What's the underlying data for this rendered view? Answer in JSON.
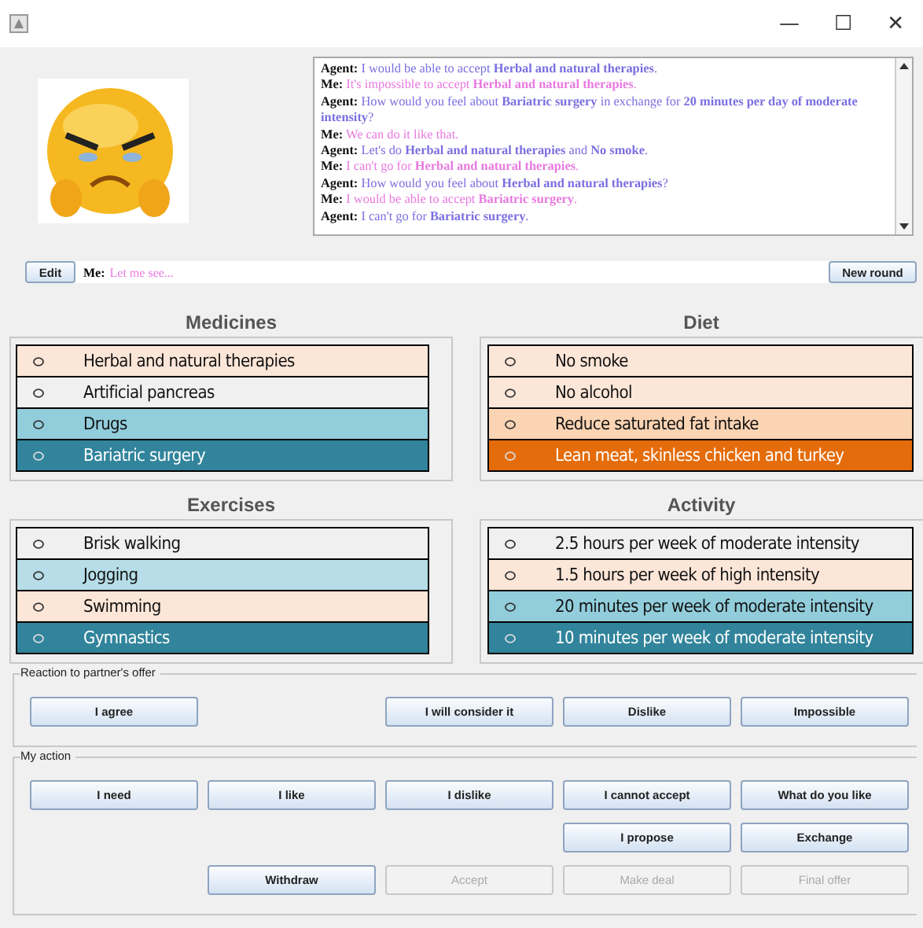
{
  "window": {
    "controls": [
      "—",
      "☐",
      "✕"
    ]
  },
  "chat": [
    {
      "kind": "agent",
      "speaker": "Agent:",
      "text": "I would be able to accept **Herbal and natural therapies**."
    },
    {
      "kind": "me",
      "speaker": "Me:",
      "text": "It's impossible to accept **Herbal and natural therapies**."
    },
    {
      "kind": "agent",
      "speaker": "Agent:",
      "text": "How would you feel about **Bariatric surgery** in exchange for **20 minutes per day of moderate intensity**?"
    },
    {
      "kind": "me",
      "speaker": "Me:",
      "text": "We can do it like that."
    },
    {
      "kind": "agent",
      "speaker": "Agent:",
      "text": "Let's do **Herbal and natural therapies** and **No smoke**."
    },
    {
      "kind": "me",
      "speaker": "Me:",
      "text": "I can't go for **Herbal and natural therapies**."
    },
    {
      "kind": "agent",
      "speaker": "Agent:",
      "text": "How would you feel about **Herbal and natural therapies**?"
    },
    {
      "kind": "me",
      "speaker": "Me:",
      "text": "I would be able to accept **Bariatric surgery**."
    },
    {
      "kind": "agent",
      "speaker": "Agent:",
      "text": "I can't go for **Bariatric surgery**."
    }
  ],
  "compose": {
    "edit_button": "Edit",
    "speaker": "Me:",
    "placeholder": "Let me see...",
    "new_round_button": "New round"
  },
  "panels": [
    {
      "title": "Medicines",
      "items": [
        {
          "label": "Herbal and natural therapies",
          "color": "#fce6d8"
        },
        {
          "label": "Artificial pancreas",
          "color": "#f0f0f0"
        },
        {
          "label": "Drugs",
          "color": "#92cddb"
        },
        {
          "label": "Bariatric surgery",
          "color": "#31849b"
        }
      ]
    },
    {
      "title": "Diet",
      "items": [
        {
          "label": "No smoke",
          "color": "#fce6d8"
        },
        {
          "label": "No alcohol",
          "color": "#fce6d8"
        },
        {
          "label": "Reduce saturated fat intake",
          "color": "#fbd4b4"
        },
        {
          "label": "Lean meat, skinless chicken and turkey",
          "color": "#e46c0a"
        }
      ]
    },
    {
      "title": "Exercises",
      "items": [
        {
          "label": "Brisk walking",
          "color": "#f0f0f0"
        },
        {
          "label": "Jogging",
          "color": "#b6dde8"
        },
        {
          "label": "Swimming",
          "color": "#fce6d8"
        },
        {
          "label": "Gymnastics",
          "color": "#31849b"
        }
      ]
    },
    {
      "title": "Activity",
      "items": [
        {
          "label": "2.5 hours per week of moderate intensity",
          "color": "#f0f0f0"
        },
        {
          "label": "1.5 hours per week of high intensity",
          "color": "#fce6d8"
        },
        {
          "label": "20 minutes per week of moderate intensity",
          "color": "#92cddb"
        },
        {
          "label": "10 minutes per week of moderate intensity",
          "color": "#31849b"
        }
      ]
    }
  ],
  "groups": [
    {
      "title": "Reaction to partner's offer",
      "rows": [
        {
          "left": [
            {
              "label": "I agree",
              "disabled": false
            }
          ],
          "right": [
            {
              "label": "I will consider it",
              "disabled": false
            },
            {
              "label": "Dislike",
              "disabled": false
            },
            {
              "label": "Impossible",
              "disabled": false
            }
          ]
        }
      ]
    },
    {
      "title": "My action",
      "rows": [
        {
          "left": [
            {
              "label": "I need",
              "disabled": false
            },
            {
              "label": "I like",
              "disabled": false
            },
            {
              "label": "I dislike",
              "disabled": false
            },
            {
              "label": "I cannot accept",
              "disabled": false
            },
            {
              "label": "What do you like",
              "disabled": false
            }
          ],
          "right": []
        },
        {
          "left": [],
          "right": [
            {
              "label": "I propose",
              "disabled": false
            },
            {
              "label": "Exchange",
              "disabled": false
            }
          ]
        },
        {
          "left": [],
          "right": [
            {
              "label": "Withdraw",
              "disabled": false
            },
            {
              "label": "Accept",
              "disabled": true
            },
            {
              "label": "Make deal",
              "disabled": true
            },
            {
              "label": "Final offer",
              "disabled": true
            }
          ]
        }
      ]
    }
  ]
}
